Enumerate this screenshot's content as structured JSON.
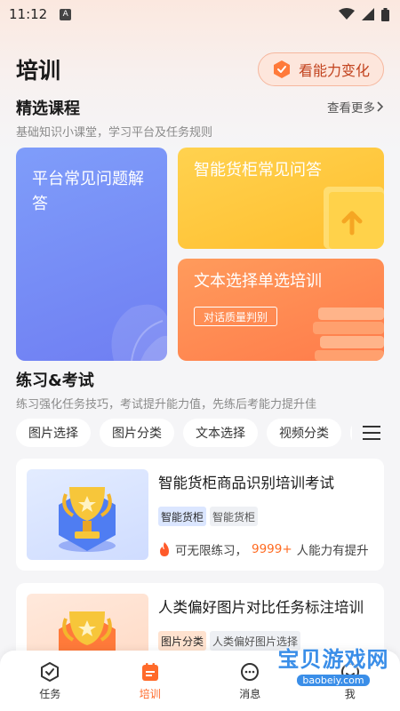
{
  "status": {
    "time": "11:12",
    "a_label": "A"
  },
  "header": {
    "title": "培训",
    "ability_button": "看能力变化"
  },
  "featured": {
    "title": "精选课程",
    "subtitle": "基础知识小课堂，学习平台及任务规则",
    "more": "查看更多",
    "cards": [
      {
        "title": "平台常见问题解答"
      },
      {
        "title": "智能货柜常见问答"
      },
      {
        "title": "文本选择单选培训",
        "tag": "对话质量判别"
      }
    ]
  },
  "practice": {
    "title": "练习&考试",
    "subtitle": "练习强化任务技巧，考试提升能力值，先练后考能力提升佳",
    "chips": [
      "图片选择",
      "图片分类",
      "文本选择",
      "视频分类"
    ]
  },
  "exams": [
    {
      "title": "智能货柜商品识别培训考试",
      "tags": [
        "智能货柜",
        "智能货柜"
      ],
      "meta_prefix": "可无限练习，",
      "meta_count": "9999+",
      "meta_suffix": " 人能力有提升"
    },
    {
      "title": "人类偏好图片对比任务标注培训",
      "tags": [
        "图片分类",
        "人类偏好图片选择"
      ]
    }
  ],
  "nav": {
    "items": [
      "任务",
      "培训",
      "消息",
      "我"
    ],
    "active_index": 1
  },
  "watermark": {
    "text": "宝贝游戏网",
    "url": "baobeiy.com"
  },
  "colors": {
    "accent": "#ff6a2a",
    "blue_card": "#7f9dfa",
    "yellow_card": "#ffc83a",
    "orange_card": "#ff8a52"
  }
}
